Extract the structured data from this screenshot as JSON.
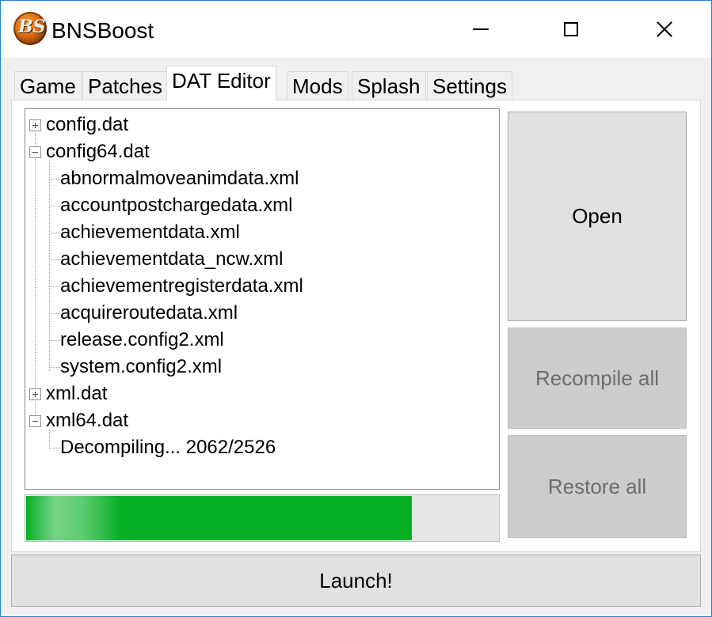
{
  "window": {
    "title": "BNSBoost",
    "logo_text": "BS"
  },
  "tabs": [
    {
      "label": "Game"
    },
    {
      "label": "Patches"
    },
    {
      "label": "DAT Editor",
      "active": true
    },
    {
      "label": "Mods"
    },
    {
      "label": "Splash"
    },
    {
      "label": "Settings"
    }
  ],
  "tree": {
    "nodes": [
      {
        "label": "config.dat",
        "expander": "plus"
      },
      {
        "label": "config64.dat",
        "expander": "minus"
      },
      {
        "label": "abnormalmoveanimdata.xml"
      },
      {
        "label": "accountpostchargedata.xml"
      },
      {
        "label": "achievementdata.xml"
      },
      {
        "label": "achievementdata_ncw.xml"
      },
      {
        "label": "achievementregisterdata.xml"
      },
      {
        "label": "acquireroutedata.xml"
      },
      {
        "label": "release.config2.xml"
      },
      {
        "label": "system.config2.xml"
      },
      {
        "label": "xml.dat",
        "expander": "plus"
      },
      {
        "label": "xml64.dat",
        "expander": "minus"
      },
      {
        "label": "Decompiling... 2062/2526"
      }
    ]
  },
  "progress": {
    "value": 2062,
    "max": 2526,
    "color": "#06b025"
  },
  "buttons": {
    "open": "Open",
    "recompile_all": "Recompile all",
    "restore_all": "Restore all",
    "launch": "Launch!"
  }
}
